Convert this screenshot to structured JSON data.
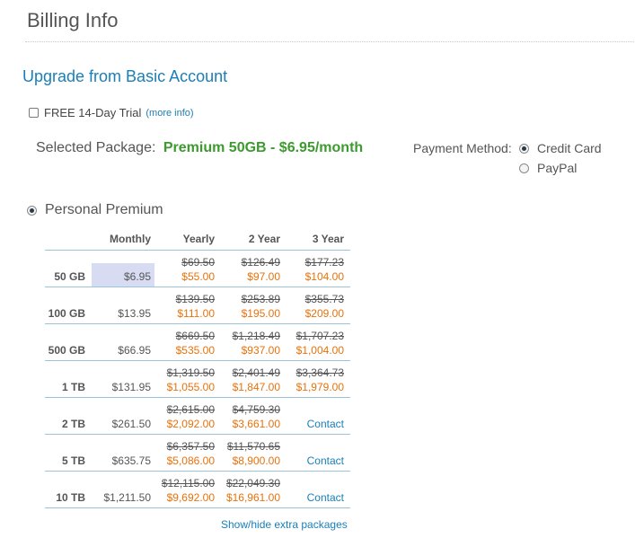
{
  "header": {
    "title": "Billing Info",
    "subtitle": "Upgrade from Basic Account"
  },
  "trial": {
    "label": "FREE 14-Day Trial",
    "more_info": "(more info)",
    "checked": false
  },
  "selected_package": {
    "label": "Selected Package:",
    "value": "Premium 50GB - $6.95/month"
  },
  "payment": {
    "label": "Payment Method:",
    "options": [
      {
        "label": "Credit Card",
        "selected": true
      },
      {
        "label": "PayPal",
        "selected": false
      }
    ]
  },
  "plan": {
    "label": "Personal Premium",
    "selected": true
  },
  "table": {
    "columns": [
      "Monthly",
      "Yearly",
      "2 Year",
      "3 Year"
    ],
    "rows": [
      {
        "size": "50 GB",
        "monthly": "$6.95",
        "yearly_old": "$69.50",
        "yearly": "$55.00",
        "y2_old": "$126.49",
        "y2": "$97.00",
        "y3_old": "$177.23",
        "y3": "$104.00"
      },
      {
        "size": "100 GB",
        "monthly": "$13.95",
        "yearly_old": "$139.50",
        "yearly": "$111.00",
        "y2_old": "$253.89",
        "y2": "$195.00",
        "y3_old": "$355.73",
        "y3": "$209.00"
      },
      {
        "size": "500 GB",
        "monthly": "$66.95",
        "yearly_old": "$669.50",
        "yearly": "$535.00",
        "y2_old": "$1,218.49",
        "y2": "$937.00",
        "y3_old": "$1,707.23",
        "y3": "$1,004.00"
      },
      {
        "size": "1 TB",
        "monthly": "$131.95",
        "yearly_old": "$1,319.50",
        "yearly": "$1,055.00",
        "y2_old": "$2,401.49",
        "y2": "$1,847.00",
        "y3_old": "$3,364.73",
        "y3": "$1,979.00"
      },
      {
        "size": "2 TB",
        "monthly": "$261.50",
        "yearly_old": "$2,615.00",
        "yearly": "$2,092.00",
        "y2_old": "$4,759.30",
        "y2": "$3,661.00",
        "y3_contact": "Contact"
      },
      {
        "size": "5 TB",
        "monthly": "$635.75",
        "yearly_old": "$6,357.50",
        "yearly": "$5,086.00",
        "y2_old": "$11,570.65",
        "y2": "$8,900.00",
        "y3_contact": "Contact"
      },
      {
        "size": "10 TB",
        "monthly": "$1,211.50",
        "yearly_old": "$12,115.00",
        "yearly": "$9,692.00",
        "y2_old": "$22,049.30",
        "y2": "$16,961.00",
        "y3_contact": "Contact"
      }
    ]
  },
  "show_hide": "Show/hide extra packages"
}
